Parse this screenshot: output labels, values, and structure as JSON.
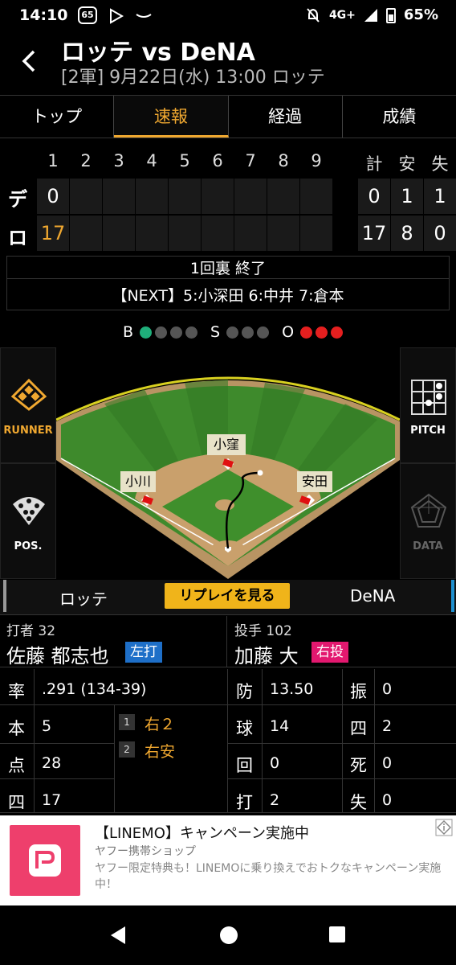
{
  "statusbar": {
    "time": "14:10",
    "badge": "65",
    "network": "4G+",
    "battery": "65%"
  },
  "header": {
    "title": "ロッテ vs DeNA",
    "subtitle": "[2軍] 9月22日(水) 13:00 ロッテ"
  },
  "tabs": [
    {
      "label": "トップ",
      "active": false
    },
    {
      "label": "速報",
      "active": true
    },
    {
      "label": "経過",
      "active": false
    },
    {
      "label": "成績",
      "active": false
    }
  ],
  "scoreboard": {
    "innings": [
      "1",
      "2",
      "3",
      "4",
      "5",
      "6",
      "7",
      "8",
      "9"
    ],
    "total_headers": [
      "計",
      "安",
      "失"
    ],
    "teams": [
      {
        "abbr": "デ",
        "innings": [
          "0",
          "",
          "",
          "",
          "",
          "",
          "",
          "",
          ""
        ],
        "totals": [
          "0",
          "1",
          "1"
        ]
      },
      {
        "abbr": "ロ",
        "innings": [
          "17",
          "",
          "",
          "",
          "",
          "",
          "",
          "",
          ""
        ],
        "totals": [
          "17",
          "8",
          "0"
        ]
      }
    ]
  },
  "game_status": {
    "inning": "1回裏 終了",
    "next": "【NEXT】5:小深田 6:中井 7:倉本"
  },
  "count": {
    "b_label": "B",
    "s_label": "S",
    "o_label": "O",
    "balls": 1,
    "strikes": 0,
    "outs": 3
  },
  "field": {
    "runner_label": "RUNNER",
    "pitch_label": "PITCH",
    "pos_label": "POS.",
    "data_label": "DATA",
    "fielders": {
      "cf": "小窪",
      "lf": "小川",
      "rf": "安田"
    }
  },
  "teambar": {
    "home": "ロッテ",
    "replay": "リプレイを見る",
    "away": "DeNA"
  },
  "batter": {
    "role": "打者 32",
    "name": "佐藤 都志也",
    "hand": "左打",
    "hand_color": "#1e6fc8"
  },
  "pitcher": {
    "role": "投手 102",
    "name": "加藤 大",
    "hand": "右投",
    "hand_color": "#e3186f"
  },
  "batter_stats": {
    "rate_k": "率",
    "rate_v": ".291 (134-39)",
    "hr_k": "本",
    "hr_v": "5",
    "rbi_k": "点",
    "rbi_v": "28",
    "bb_k": "四",
    "bb_v": "17",
    "at_bats": [
      {
        "n": "1",
        "result": "右２"
      },
      {
        "n": "2",
        "result": "右安"
      }
    ]
  },
  "pitcher_stats": {
    "era_k": "防",
    "era_v": "13.50",
    "so_k": "振",
    "so_v": "0",
    "np_k": "球",
    "np_v": "14",
    "bb_k": "四",
    "bb_v": "2",
    "ip_k": "回",
    "ip_v": "0",
    "hbp_k": "死",
    "hbp_v": "0",
    "h_k": "打",
    "h_v": "2",
    "er_k": "失",
    "er_v": "0"
  },
  "ad": {
    "headline": "【LINEMO】キャンペーン実施中",
    "source": "ヤフー携帯ショップ",
    "desc": "ヤフー限定特典も！LINEMOに乗り換えでおトクなキャンペーン実施中！"
  }
}
